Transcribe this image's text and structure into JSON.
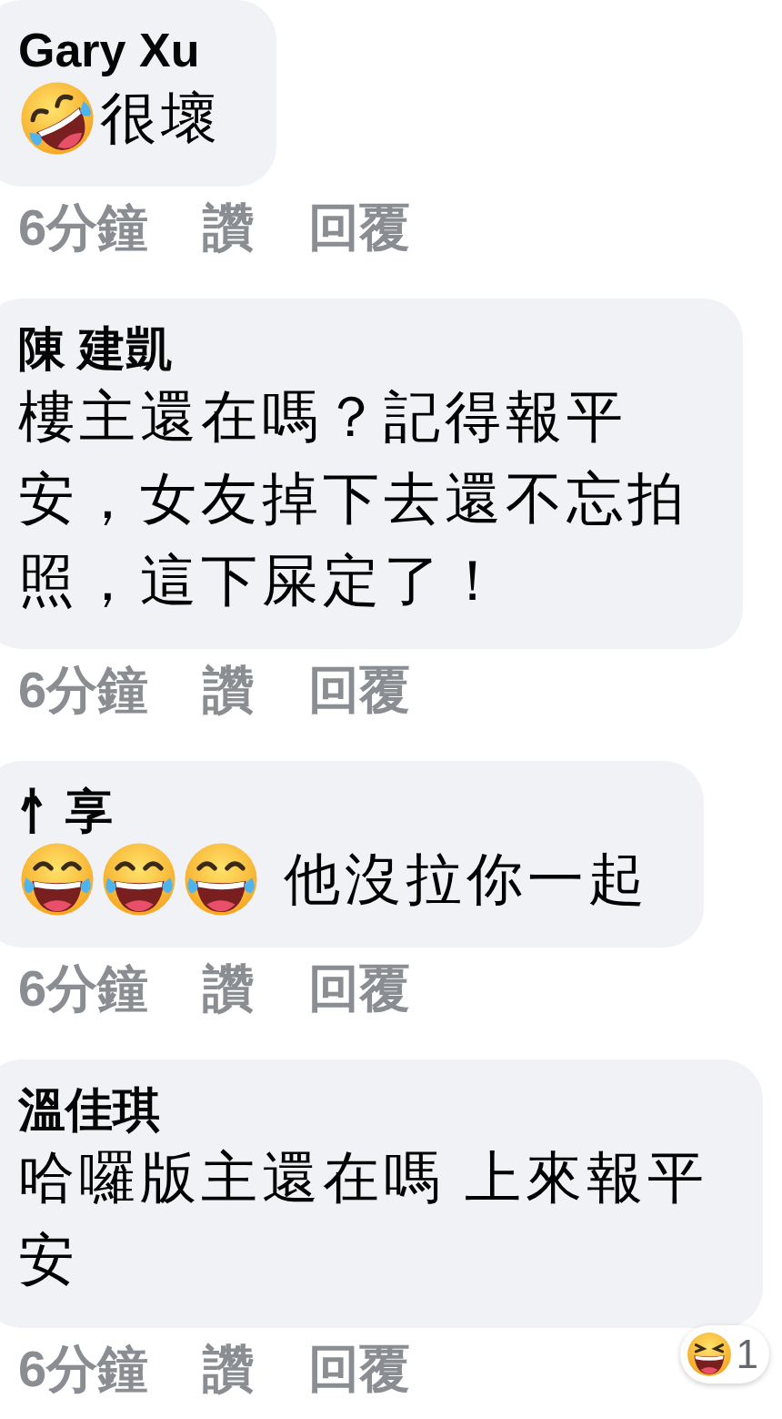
{
  "comments": [
    {
      "author": "Gary Xu",
      "body": [
        {
          "kind": "rolling"
        },
        {
          "kind": "text",
          "lines": [
            "很壞"
          ]
        }
      ],
      "time": "6分鐘",
      "like": "讚",
      "reply": "回覆"
    },
    {
      "author": "陳 建凱",
      "body": [
        {
          "kind": "text",
          "lines": [
            "樓主還在嗎？記得報平",
            "安，女友掉下去還不忘拍",
            "照，這下屎定了！"
          ]
        }
      ],
      "time": "6分鐘",
      "like": "讚",
      "reply": "回覆"
    },
    {
      "author": "忄享",
      "body": [
        {
          "kind": "joy"
        },
        {
          "kind": "joy"
        },
        {
          "kind": "joy"
        },
        {
          "kind": "text",
          "lines": [
            " 他沒拉你一起"
          ]
        }
      ],
      "time": "6分鐘",
      "like": "讚",
      "reply": "回覆"
    },
    {
      "author": "溫佳琪",
      "body": [
        {
          "kind": "text",
          "lines": [
            "哈囉版主還在嗎 上來報平",
            "安"
          ]
        }
      ],
      "time": "6分鐘",
      "like": "讚",
      "reply": "回覆",
      "reactions": {
        "count": "1"
      }
    }
  ]
}
